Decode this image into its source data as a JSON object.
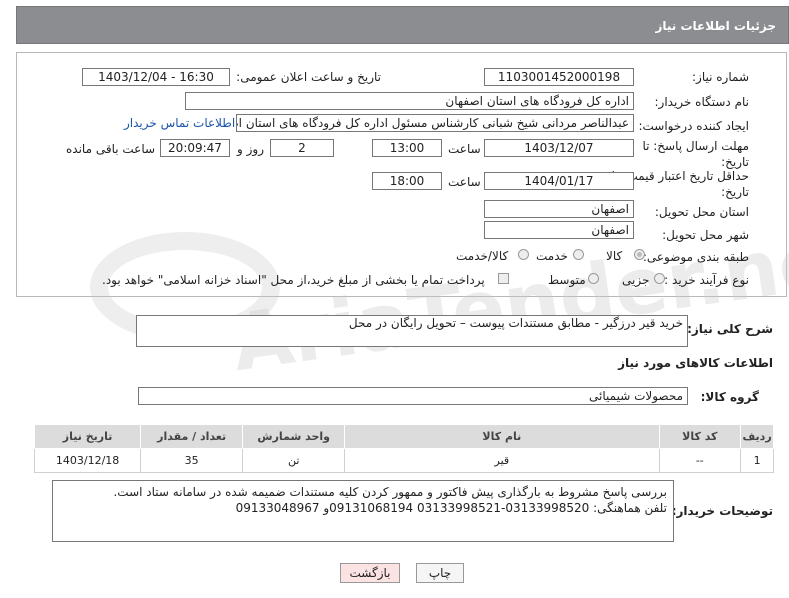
{
  "header": {
    "title": "جزئیات اطلاعات نیاز"
  },
  "fields": {
    "need_number_label": "شماره نیاز:",
    "need_number": "1103001452000198",
    "announce_label": "تاریخ و ساعت اعلان عمومی:",
    "announce_value": "1403/12/04 - 16:30",
    "buyer_org_label": "نام دستگاه خریدار:",
    "buyer_org": "اداره کل فرودگاه های استان اصفهان",
    "creator_label": "ایجاد کننده درخواست:",
    "creator": "عبدالناصر مردانی شیخ شبانی کارشناس مسئول  اداره کل فرودگاه های استان اصفهان",
    "contact_link": "اطلاعات تماس خریدار",
    "deadline_label": "مهلت ارسال پاسخ: تا تاریخ:",
    "deadline_date": "1403/12/07",
    "time_label": "ساعت",
    "deadline_time": "13:00",
    "days": "2",
    "days_label": "روز و",
    "remaining_time": "20:09:47",
    "remaining_label": "ساعت باقی مانده",
    "validity_label": "حداقل تاریخ اعتبار قیمت: تا تاریخ:",
    "validity_date": "1404/01/17",
    "validity_time": "18:00",
    "province_label": "استان محل تحویل:",
    "province": "اصفهان",
    "city_label": "شهر محل تحویل:",
    "city": "اصفهان",
    "category_label": "طبقه بندی موضوعی:",
    "category_options": [
      "کالا",
      "خدمت",
      "کالا/خدمت"
    ],
    "purchase_type_label": "نوع فرآیند خرید :",
    "purchase_options": [
      "جزیی",
      "متوسط"
    ],
    "payment_note": "پرداخت تمام یا بخشی از مبلغ خرید،از محل \"اسناد خزانه اسلامی\" خواهد بود."
  },
  "description": {
    "label": "شرح کلی نیاز:",
    "text": "خرید قیر درزگیر - مطابق مستندات پیوست – تحویل رایگان در محل"
  },
  "goods": {
    "section_title": "اطلاعات کالاهای مورد نیاز",
    "group_label": "گروه کالا:",
    "group_value": "محصولات شیمیائی",
    "columns": [
      "ردیف",
      "کد کالا",
      "نام کالا",
      "واحد شمارش",
      "تعداد / مقدار",
      "تاریخ نیاز"
    ],
    "rows": [
      {
        "idx": "1",
        "code": "--",
        "name": "قیر",
        "unit": "تن",
        "qty": "35",
        "date": "1403/12/18"
      }
    ]
  },
  "buyer_notes": {
    "label": "توضیحات خریدار:",
    "line1": "بررسی پاسخ مشروط  به بارگذاری پیش فاکتور و ممهور کردن کلیه مستندات ضمیمه شده در سامانه  ستاد است.",
    "line2": "تلفن هماهنگی:  03133998520-03133998521  09131068194و 09133048967"
  },
  "buttons": {
    "print": "چاپ",
    "back": "بازگشت"
  },
  "watermark": "AriaTender.net"
}
